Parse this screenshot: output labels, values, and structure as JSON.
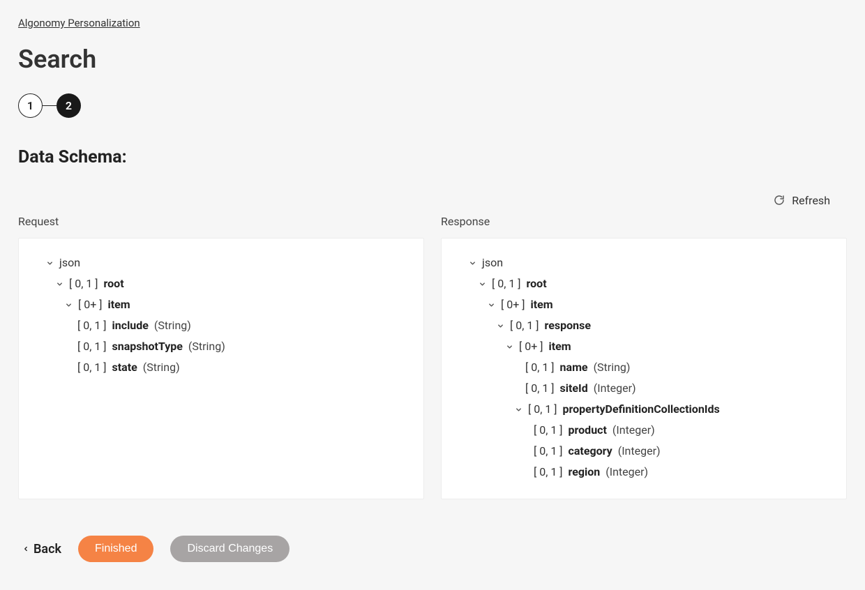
{
  "breadcrumb": "Algonomy Personalization",
  "title": "Search",
  "stepper": {
    "step1": "1",
    "step2": "2"
  },
  "section": "Data Schema:",
  "refresh_label": "Refresh",
  "columns": {
    "request": "Request",
    "response": "Response"
  },
  "request": {
    "root_label": "json",
    "l1": {
      "card": "[ 0, 1 ]",
      "name": "root"
    },
    "l2": {
      "card": "[ 0+ ]",
      "name": "item"
    },
    "leaves": {
      "a": {
        "card": "[ 0, 1 ]",
        "name": "include",
        "type": "(String)"
      },
      "b": {
        "card": "[ 0, 1 ]",
        "name": "snapshotType",
        "type": "(String)"
      },
      "c": {
        "card": "[ 0, 1 ]",
        "name": "state",
        "type": "(String)"
      }
    }
  },
  "response": {
    "root_label": "json",
    "l1": {
      "card": "[ 0, 1 ]",
      "name": "root"
    },
    "l2": {
      "card": "[ 0+ ]",
      "name": "item"
    },
    "l3": {
      "card": "[ 0, 1 ]",
      "name": "response"
    },
    "l4": {
      "card": "[ 0+ ]",
      "name": "item"
    },
    "leaves5": {
      "a": {
        "card": "[ 0, 1 ]",
        "name": "name",
        "type": "(String)"
      },
      "b": {
        "card": "[ 0, 1 ]",
        "name": "siteId",
        "type": "(Integer)"
      }
    },
    "l5expand": {
      "card": "[ 0, 1 ]",
      "name": "propertyDefinitionCollectionIds"
    },
    "leaves6": {
      "a": {
        "card": "[ 0, 1 ]",
        "name": "product",
        "type": "(Integer)"
      },
      "b": {
        "card": "[ 0, 1 ]",
        "name": "category",
        "type": "(Integer)"
      },
      "c": {
        "card": "[ 0, 1 ]",
        "name": "region",
        "type": "(Integer)"
      }
    }
  },
  "footer": {
    "back": "Back",
    "finished": "Finished",
    "discard": "Discard Changes"
  }
}
